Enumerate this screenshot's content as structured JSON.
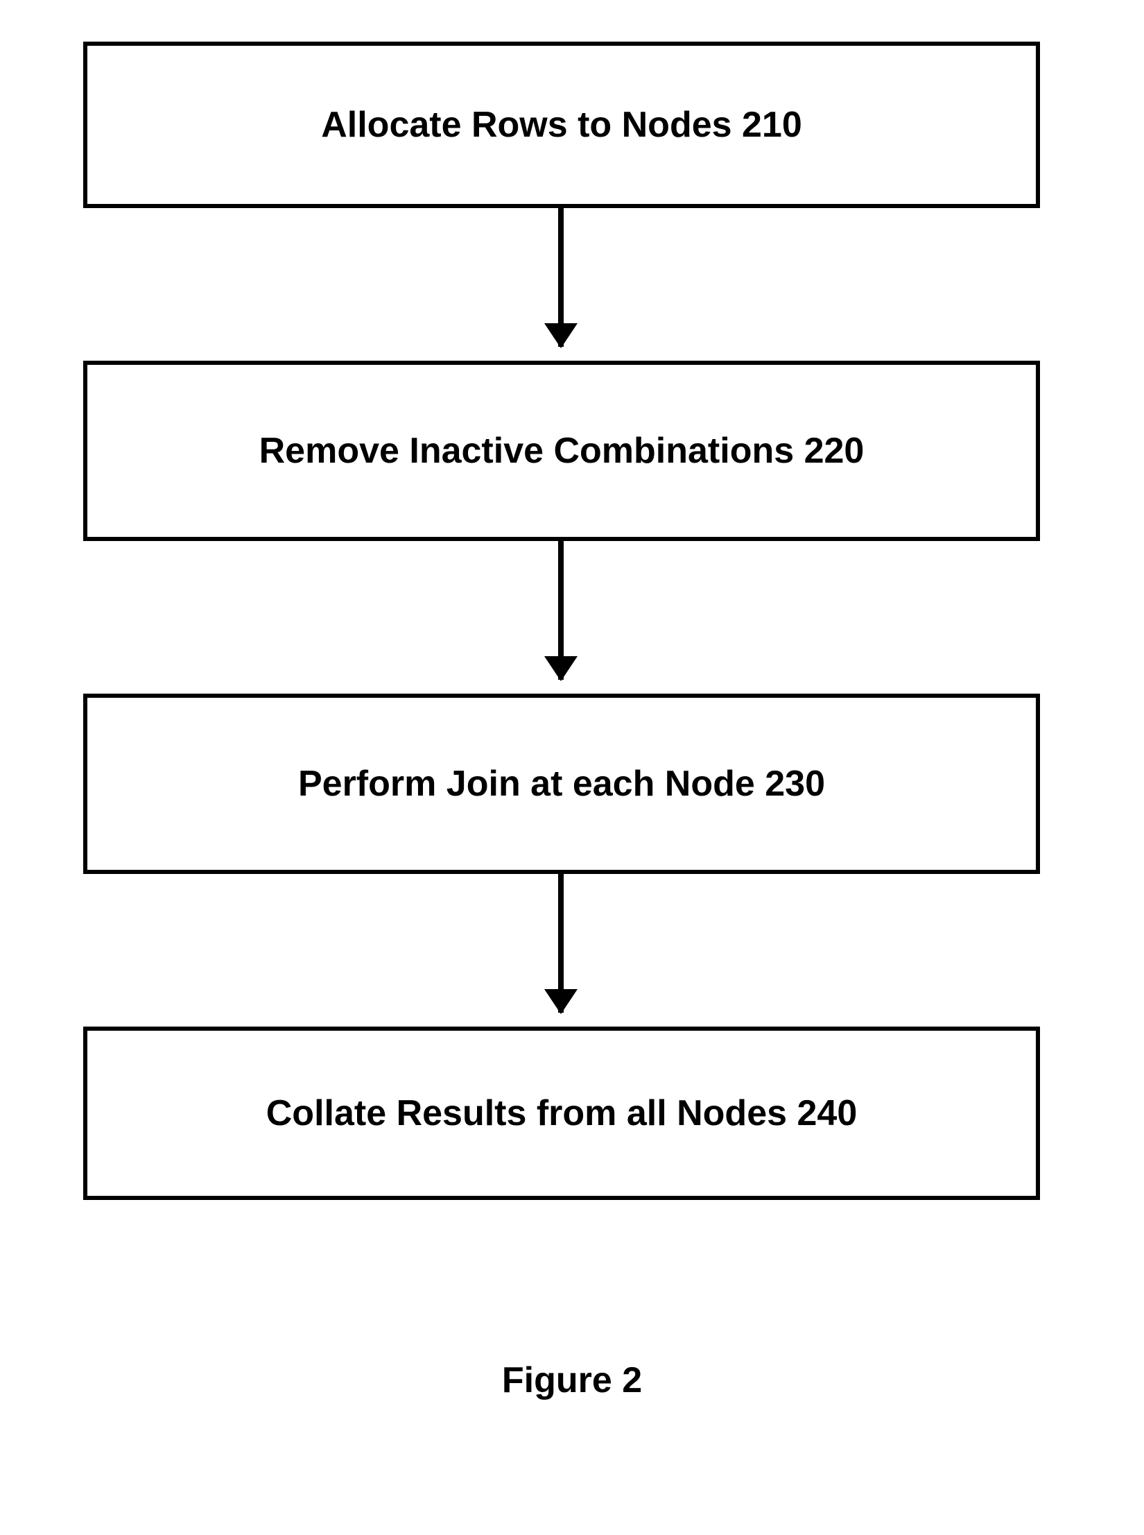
{
  "figure_label": "Figure 2",
  "steps": [
    {
      "label": "Allocate Rows to Nodes 210"
    },
    {
      "label": "Remove Inactive Combinations 220"
    },
    {
      "label": "Perform Join at each Node 230"
    },
    {
      "label": "Collate Results from all Nodes 240"
    }
  ]
}
